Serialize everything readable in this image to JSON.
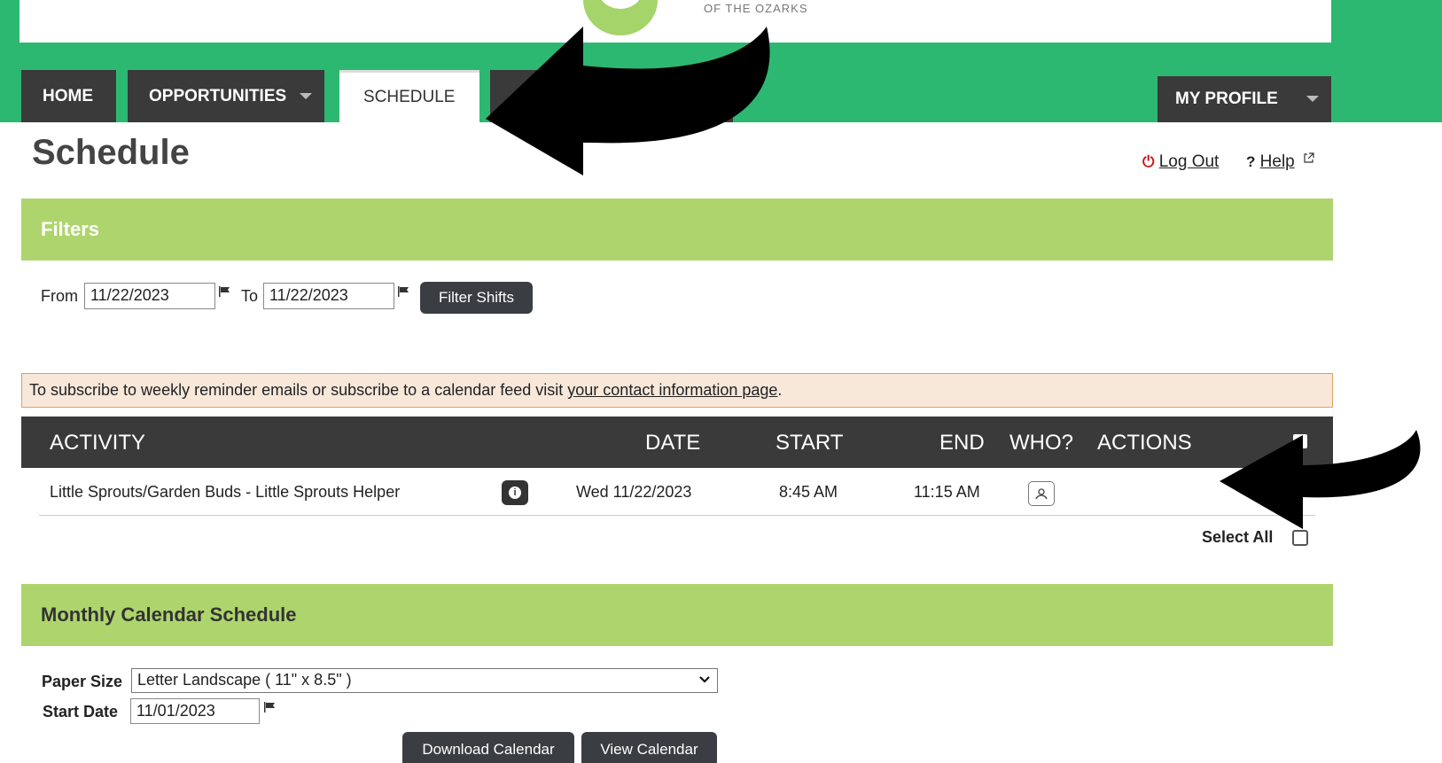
{
  "header": {
    "logo_text": "OF THE OZARKS"
  },
  "nav": {
    "home": "HOME",
    "opportunities": "OPPORTUNITIES",
    "schedule": "SCHEDULE",
    "my_profile": "MY PROFILE"
  },
  "page": {
    "title": "Schedule",
    "logout": "Log Out",
    "help_mark": "?",
    "help": "Help"
  },
  "filters": {
    "header": "Filters",
    "from_label": "From",
    "from_value": "11/22/2023",
    "to_label": "To",
    "to_value": "11/22/2023",
    "button": "Filter Shifts"
  },
  "notice": {
    "text": "To subscribe to weekly reminder emails or subscribe to a calendar feed visit ",
    "link": "your contact information page",
    "tail": "."
  },
  "table": {
    "headers": [
      "ACTIVITY",
      "DATE",
      "START",
      "END",
      "WHO?",
      "ACTIONS"
    ],
    "rows": [
      {
        "activity": "Little Sprouts/Garden Buds - Little Sprouts Helper",
        "date": "Wed 11/22/2023",
        "start": "8:45 AM",
        "end": "11:15 AM"
      }
    ],
    "select_all": "Select All"
  },
  "calendar": {
    "header": "Monthly Calendar Schedule",
    "paper_label": "Paper Size",
    "paper_value": "Letter Landscape ( 11\" x 8.5\" )",
    "start_label": "Start Date",
    "start_value": "11/01/2023",
    "download_button": "Download Calendar",
    "view_button": "View Calendar"
  },
  "colors": {
    "brand_green": "#2db872",
    "section_green": "#aed56d",
    "nav_dark": "#3a3a3a",
    "notice_bg": "#f7e8da"
  }
}
